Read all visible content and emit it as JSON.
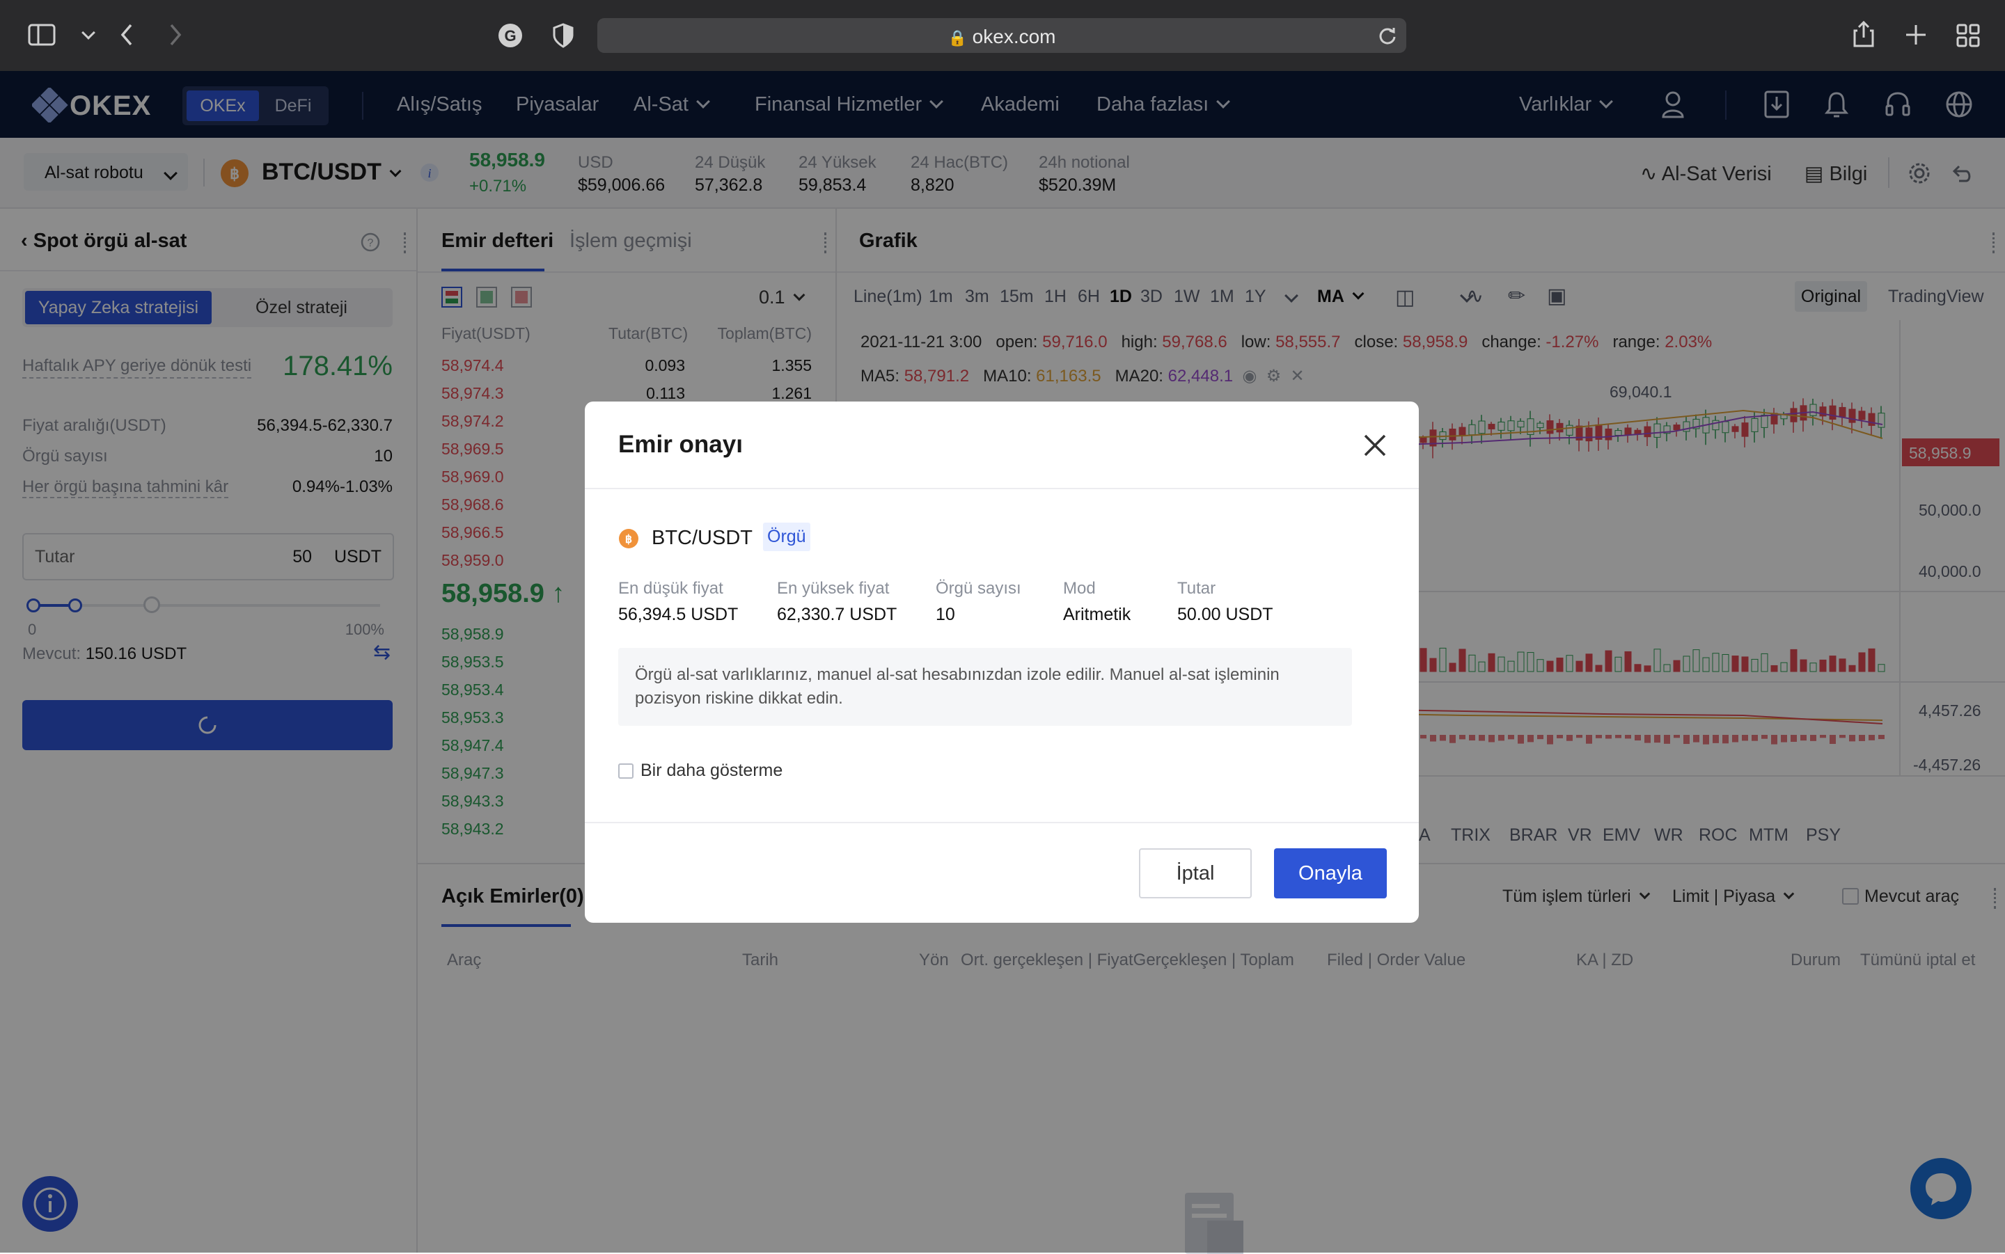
{
  "browser": {
    "url": "okex.com"
  },
  "nav": {
    "logo": "OKEX",
    "segments": [
      "OKEx",
      "DeFi"
    ],
    "items": [
      "Alış/Satış",
      "Piyasalar",
      "Al-Sat",
      "Finansal Hizmetler",
      "Akademi",
      "Daha fazlası"
    ],
    "assets": "Varlıklar"
  },
  "ticker": {
    "bot_select": "Al-sat robotu",
    "pair": "BTC/USDT",
    "last_price": "58,958.9",
    "change": "+0.71%",
    "stats": [
      {
        "label": "USD",
        "value": "$59,006.66"
      },
      {
        "label": "24 Düşük",
        "value": "57,362.8"
      },
      {
        "label": "24 Yüksek",
        "value": "59,853.4"
      },
      {
        "label": "24 Hac(BTC)",
        "value": "8,820"
      },
      {
        "label": "24h notional",
        "value": "$520.39M"
      }
    ],
    "trade_data": "Al-Sat Verisi",
    "info": "Bilgi"
  },
  "left_panel": {
    "title": "Spot örgü al-sat",
    "tabs": [
      "Yapay Zeka stratejisi",
      "Özel strateji"
    ],
    "apy_label": "Haftalık APY geriye dönük testi",
    "apy_value": "178.41%",
    "rows": [
      {
        "label": "Fiyat aralığı(USDT)",
        "value": "56,394.5-62,330.7"
      },
      {
        "label": "Örgü sayısı",
        "value": "10"
      },
      {
        "label": "Her örgü başına tahmini kâr",
        "value": "0.94%-1.03%"
      }
    ],
    "amount_label": "Tutar",
    "amount_value": "50",
    "amount_unit": "USDT",
    "slider_min": "0",
    "slider_max": "100%",
    "slider_level": 0.12,
    "available_label": "Mevcut:",
    "available_value": "150.16 USDT"
  },
  "orderbook": {
    "tabs": [
      "Emir defteri",
      "İşlem geçmişi"
    ],
    "precision": "0.1",
    "headers": [
      "Fiyat(USDT)",
      "Tutar(BTC)",
      "Toplam(BTC)"
    ],
    "asks": [
      {
        "price": "58,974.4",
        "amount": "0.093",
        "total": "1.355"
      },
      {
        "price": "58,974.3",
        "amount": "0.113",
        "total": "1.261"
      },
      {
        "price": "58,974.2",
        "amount": "",
        "total": ""
      },
      {
        "price": "58,969.5",
        "amount": "",
        "total": ""
      },
      {
        "price": "58,969.0",
        "amount": "",
        "total": ""
      },
      {
        "price": "58,968.6",
        "amount": "",
        "total": ""
      },
      {
        "price": "58,966.5",
        "amount": "",
        "total": ""
      },
      {
        "price": "58,959.0",
        "amount": "",
        "total": ""
      }
    ],
    "mid_price": "58,958.9",
    "bids": [
      {
        "price": "58,958.9"
      },
      {
        "price": "58,953.5"
      },
      {
        "price": "58,953.4"
      },
      {
        "price": "58,953.3"
      },
      {
        "price": "58,947.4"
      },
      {
        "price": "58,947.3"
      },
      {
        "price": "58,943.3"
      },
      {
        "price": "58,943.2"
      }
    ]
  },
  "chart": {
    "title": "Grafik",
    "timeframes": [
      "Line(1m)",
      "1m",
      "3m",
      "15m",
      "1H",
      "6H",
      "1D",
      "3D",
      "1W",
      "1M",
      "1Y"
    ],
    "indicator": "MA",
    "views": [
      "Original",
      "TradingView"
    ],
    "ohlc": {
      "date": "2021-11-21 3:00",
      "open_label": "open:",
      "open": "59,716.0",
      "high_label": "high:",
      "high": "59,768.6",
      "low_label": "low:",
      "low": "58,555.7",
      "close_label": "close:",
      "close": "58,958.9",
      "change_label": "change:",
      "change": "-1.27%",
      "range_label": "range:",
      "range": "2.03%"
    },
    "ma": [
      {
        "label": "MA5:",
        "value": "58,791.2"
      },
      {
        "label": "MA10:",
        "value": "61,163.5"
      },
      {
        "label": "MA20:",
        "value": "62,448.1"
      }
    ],
    "peak_label": "69,040.1",
    "price_tag": "58,958.9",
    "yaxis": [
      "50,000.0",
      "40,000.0",
      "4,457.26",
      "-4,457.26"
    ],
    "indicators": [
      "A",
      "TRIX",
      "BRAR",
      "VR",
      "EMV",
      "WR",
      "ROC",
      "MTM",
      "PSY"
    ]
  },
  "orders": {
    "tab": "Açık Emirler(0)",
    "filters": [
      "Tüm işlem türleri",
      "Limit | Piyasa"
    ],
    "current_only": "Mevcut araç",
    "columns": [
      "Araç",
      "Tarih",
      "Yön",
      "Ort. gerçekleşen | FiyatGerçekleşen | Toplam",
      "Filed | Order Value",
      "KA | ZD",
      "Durum",
      "Tümünü iptal et"
    ]
  },
  "modal": {
    "title": "Emir onayı",
    "pair": "BTC/USDT",
    "tag": "Örgü",
    "fields": [
      {
        "label": "En düşük fiyat",
        "value": "56,394.5 USDT"
      },
      {
        "label": "En yüksek fiyat",
        "value": "62,330.7 USDT"
      },
      {
        "label": "Örgü sayısı",
        "value": "10"
      },
      {
        "label": "Mod",
        "value": "Aritmetik"
      },
      {
        "label": "Tutar",
        "value": "50.00 USDT"
      }
    ],
    "notice": "Örgü al-sat varlıklarınız, manuel al-sat hesabınızdan izole edilir. Manuel al-sat işleminin pozisyon riskine dikkat edin.",
    "dont_show": "Bir daha gösterme",
    "cancel": "İptal",
    "confirm": "Onayla"
  },
  "colors": {
    "brand_blue": "#2e55d6",
    "nav_bg": "#0b1a3a",
    "up": "#2f9e55",
    "down": "#e04b54",
    "coin": "#f0923a"
  }
}
